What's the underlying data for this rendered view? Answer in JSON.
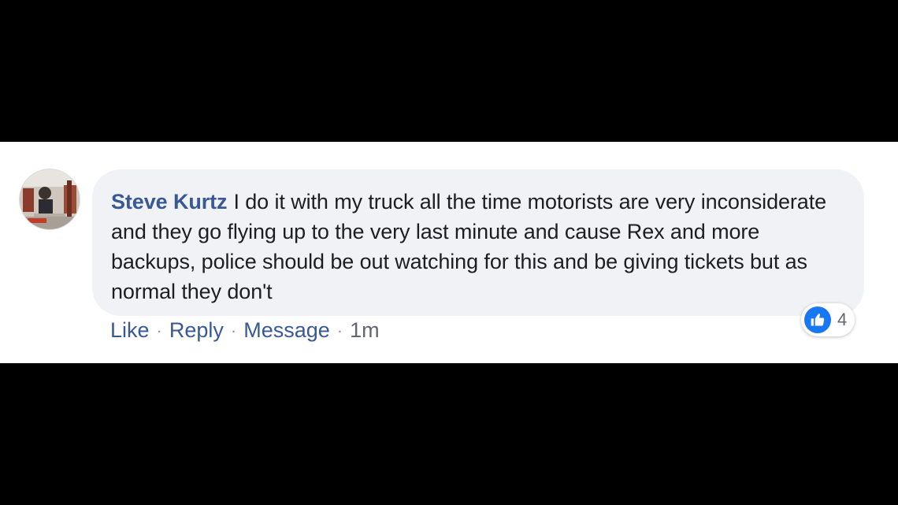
{
  "comment": {
    "author": "Steve Kurtz",
    "text": "I do it with my truck all the time motorists are very inconsiderate and they go flying up to the very last minute and cause Rex and more backups, police should be out watching for this and be giving tickets but as normal they don't",
    "avatar_icon": "profile-photo",
    "reactions": {
      "icon": "like-icon",
      "count": "4",
      "color": "#1877f2"
    }
  },
  "actions": {
    "like": "Like",
    "reply": "Reply",
    "message": "Message",
    "time": "1m",
    "separator": "·"
  },
  "colors": {
    "author": "#385898",
    "bubble": "#f0f2f5",
    "text": "#1c1e21",
    "letterbox": "#000000"
  }
}
